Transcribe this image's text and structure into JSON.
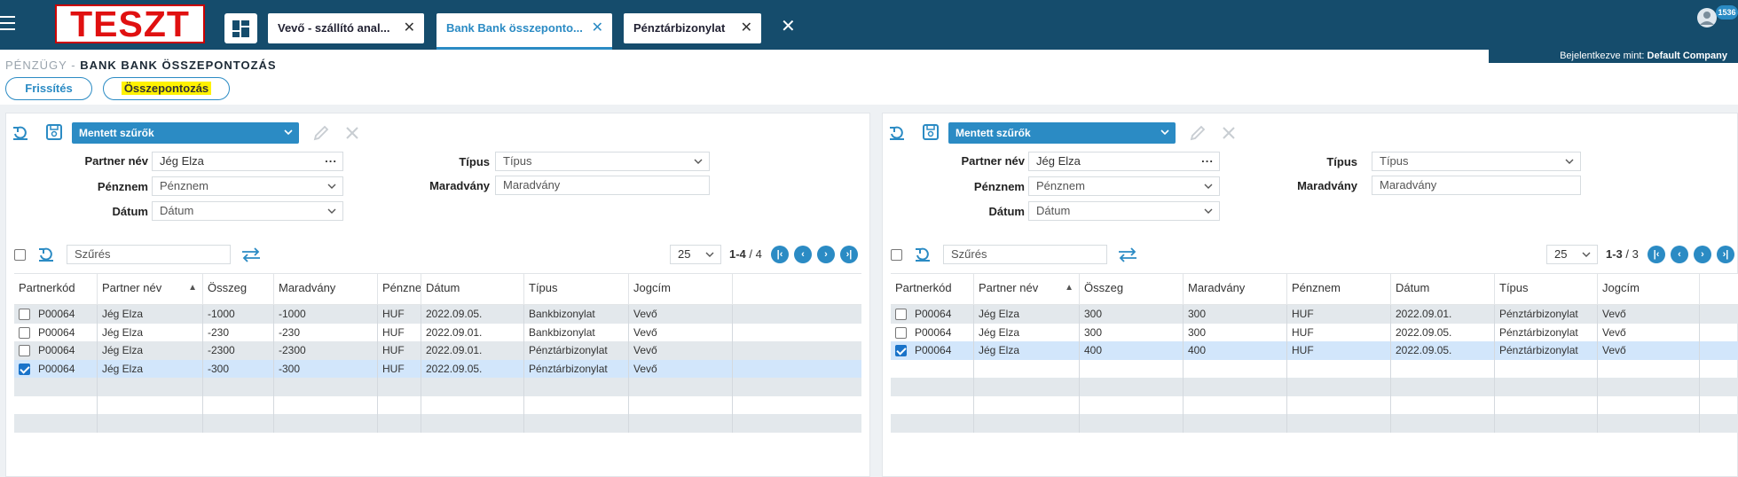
{
  "app": {
    "logo_text": "TESZT",
    "tabs": [
      {
        "label": "Vevő - szállító anal..."
      },
      {
        "label": "Bank Bank összeponto..."
      },
      {
        "label": "Pénztárbizonylat"
      }
    ],
    "notification_count": "1536"
  },
  "header": {
    "breadcrumb_parent": "PÉNZÜGY -",
    "breadcrumb_current": "BANK BANK ÖSSZEPONTOZÁS",
    "login_prefix": "Bejelentkezve mint:",
    "login_company": "Default Company",
    "refresh_label": "Frissítés",
    "match_label": "Összepontozás"
  },
  "colors": {
    "topbar": "#154c6c",
    "accent": "#2b8bc4",
    "highlight": "#fff200",
    "alt_row": "#e3e8ec",
    "selected_row": "#d2e6fb"
  },
  "left": {
    "saved_filters": "Mentett szűrők",
    "filters": {
      "partner_label": "Partner név",
      "partner_value": "Jég Elza",
      "currency_label": "Pénznem",
      "currency_placeholder": "Pénznem",
      "date_label": "Dátum",
      "date_placeholder": "Dátum",
      "type_label": "Típus",
      "type_placeholder": "Típus",
      "balance_label": "Maradvány",
      "balance_placeholder": "Maradvány"
    },
    "search_placeholder": "Szűrés",
    "per_page": "25",
    "range": "1-4",
    "total": "/ 4",
    "columns": [
      "Partnerkód",
      "Partner név",
      "Összeg",
      "Maradvány",
      "Pénznem",
      "Dátum",
      "Típus",
      "Jogcím"
    ],
    "rows": [
      {
        "checked": false,
        "cells": [
          "P00064",
          "Jég Elza",
          "-1000",
          "-1000",
          "HUF",
          "2022.09.05.",
          "Bankbizonylat",
          "Vevő"
        ]
      },
      {
        "checked": false,
        "cells": [
          "P00064",
          "Jég Elza",
          "-230",
          "-230",
          "HUF",
          "2022.09.01.",
          "Bankbizonylat",
          "Vevő"
        ]
      },
      {
        "checked": false,
        "cells": [
          "P00064",
          "Jég Elza",
          "-2300",
          "-2300",
          "HUF",
          "2022.09.01.",
          "Pénztárbizonylat",
          "Vevő"
        ]
      },
      {
        "checked": true,
        "cells": [
          "P00064",
          "Jég Elza",
          "-300",
          "-300",
          "HUF",
          "2022.09.05.",
          "Pénztárbizonylat",
          "Vevő"
        ]
      }
    ]
  },
  "right": {
    "saved_filters": "Mentett szűrők",
    "filters": {
      "partner_label": "Partner név",
      "partner_value": "Jég Elza",
      "currency_label": "Pénznem",
      "currency_placeholder": "Pénznem",
      "date_label": "Dátum",
      "date_placeholder": "Dátum",
      "type_label": "Típus",
      "type_placeholder": "Típus",
      "balance_label": "Maradvány",
      "balance_placeholder": "Maradvány"
    },
    "search_placeholder": "Szűrés",
    "per_page": "25",
    "range": "1-3",
    "total": "/ 3",
    "columns": [
      "Partnerkód",
      "Partner név",
      "Összeg",
      "Maradvány",
      "Pénznem",
      "Dátum",
      "Típus",
      "Jogcím"
    ],
    "rows": [
      {
        "checked": false,
        "cells": [
          "P00064",
          "Jég Elza",
          "300",
          "300",
          "HUF",
          "2022.09.01.",
          "Pénztárbizonylat",
          "Vevő"
        ]
      },
      {
        "checked": false,
        "cells": [
          "P00064",
          "Jég Elza",
          "300",
          "300",
          "HUF",
          "2022.09.05.",
          "Pénztárbizonylat",
          "Vevő"
        ]
      },
      {
        "checked": true,
        "cells": [
          "P00064",
          "Jég Elza",
          "400",
          "400",
          "HUF",
          "2022.09.05.",
          "Pénztárbizonylat",
          "Vevő"
        ]
      }
    ]
  }
}
